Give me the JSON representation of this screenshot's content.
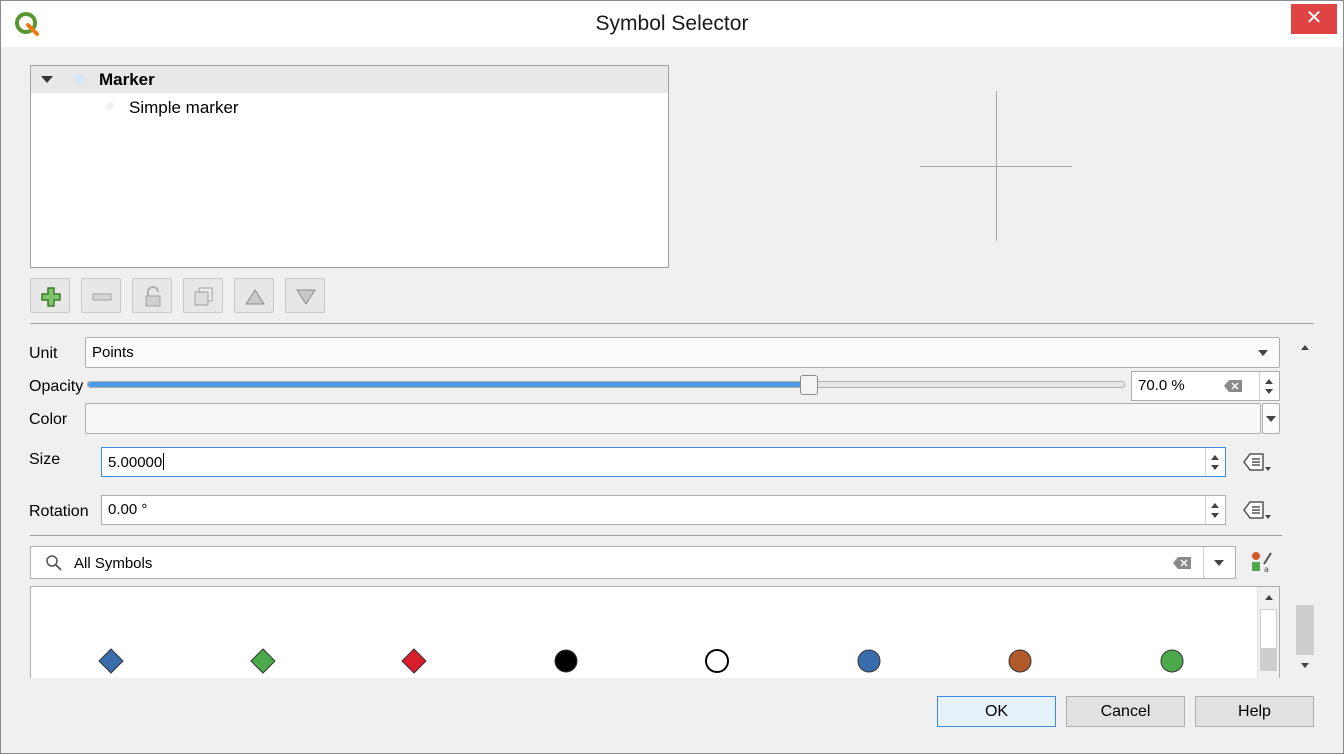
{
  "window": {
    "title": "Symbol Selector",
    "close_glyph": "✕"
  },
  "tree": {
    "root_label": "Marker",
    "child_label": "Simple marker"
  },
  "toolbar": {
    "buttons": [
      "add-layer-icon",
      "remove-layer-icon",
      "lock-icon",
      "duplicate-icon",
      "move-up-icon",
      "move-down-icon"
    ]
  },
  "form": {
    "unit_label": "Unit",
    "unit_value": "Points",
    "opacity_label": "Opacity",
    "opacity_value": "70.0 %",
    "opacity_fraction": 0.7,
    "color_label": "Color",
    "color_value": "",
    "size_label": "Size",
    "size_value": "5.00000",
    "rotation_label": "Rotation",
    "rotation_value": "0.00 °"
  },
  "search": {
    "value": "All Symbols"
  },
  "symbols": [
    {
      "shape": "diamond",
      "color": "#3a6dac"
    },
    {
      "shape": "diamond",
      "color": "#4caa4c"
    },
    {
      "shape": "diamond",
      "color": "#d81e2b"
    },
    {
      "shape": "circle",
      "color": "#000000"
    },
    {
      "shape": "circle-outline",
      "color": "#ffffff"
    },
    {
      "shape": "circle",
      "color": "#3a6dac"
    },
    {
      "shape": "circle",
      "color": "#b05a2c"
    },
    {
      "shape": "circle",
      "color": "#4caa4c"
    }
  ],
  "buttons": {
    "ok": "OK",
    "cancel": "Cancel",
    "help": "Help"
  },
  "colors": {
    "accent": "#3c8ee3",
    "slider_fill": "#4b9be8",
    "close": "#e04343"
  }
}
